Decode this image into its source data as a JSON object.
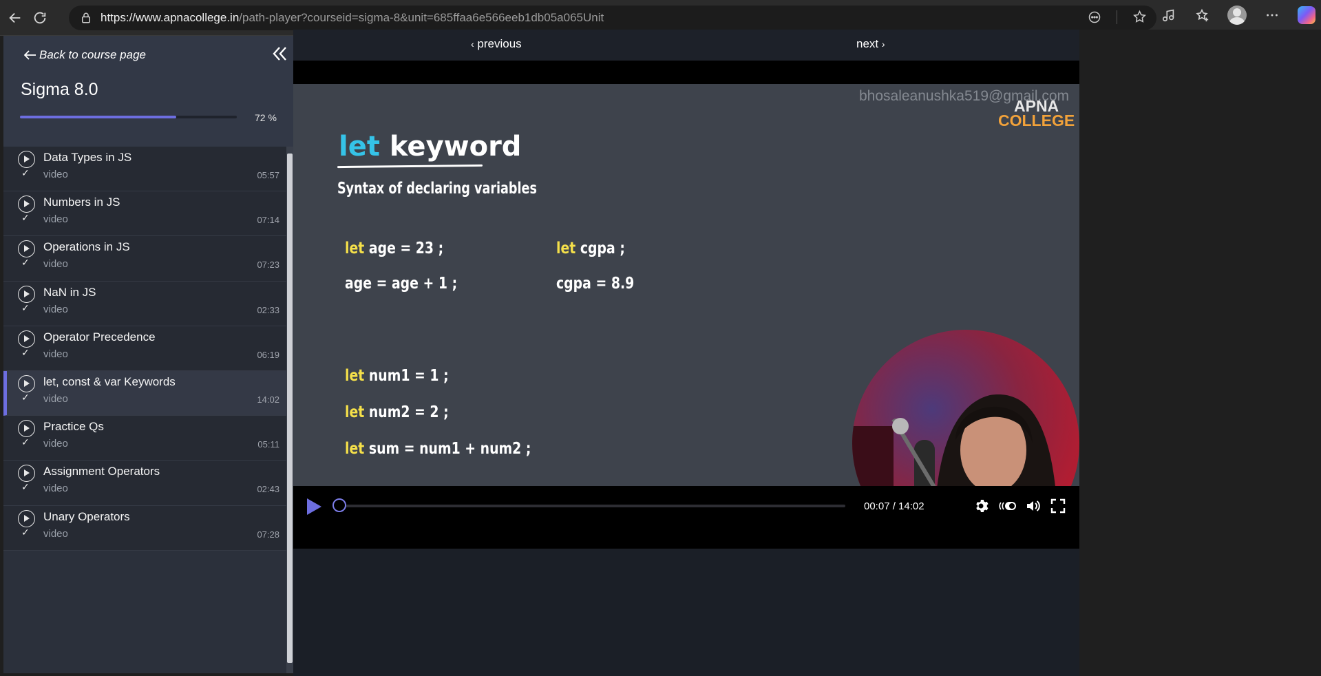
{
  "browser": {
    "url_host": "https://www.apnacollege.in",
    "url_path": "/path-player?courseid=sigma-8&unit=685ffaa6e566eeb1db05a065Unit"
  },
  "sidebar": {
    "back_label": "Back to course page",
    "course_title": "Sigma 8.0",
    "progress_label": "72 %",
    "progress_fraction": 0.72,
    "lessons": [
      {
        "title": "Data Types in JS",
        "type": "video",
        "duration": "05:57"
      },
      {
        "title": "Numbers in JS",
        "type": "video",
        "duration": "07:14"
      },
      {
        "title": "Operations in JS",
        "type": "video",
        "duration": "07:23"
      },
      {
        "title": "NaN in JS",
        "type": "video",
        "duration": "02:33"
      },
      {
        "title": " Operator Precedence",
        "type": "video",
        "duration": "06:19"
      },
      {
        "title": "let, const & var Keywords",
        "type": "video",
        "duration": "14:02"
      },
      {
        "title": "Practice Qs",
        "type": "video",
        "duration": "05:11"
      },
      {
        "title": "Assignment Operators",
        "type": "video",
        "duration": "02:43"
      },
      {
        "title": "Unary Operators",
        "type": "video",
        "duration": "07:28"
      }
    ],
    "active_index": 5
  },
  "player": {
    "previous_label": "previous",
    "next_label": "next",
    "watermark": "bhosaleanushka519@gmail.com",
    "logo_line1": "APNA",
    "logo_line2": "COLLEGE",
    "time": "00:07 / 14:02",
    "played_fraction": 0.008
  },
  "slide": {
    "title_kw": "let",
    "title_rest": "keyword",
    "subtitle": "Syntax of declaring variables",
    "code_left": [
      {
        "k": "let",
        "rest": "age = 23 ;"
      },
      {
        "k": "",
        "rest": "age = age + 1 ;"
      }
    ],
    "code_right": [
      {
        "k": "let",
        "rest": "cgpa ;"
      },
      {
        "k": "",
        "rest": "cgpa = 8.9"
      }
    ],
    "code_bottom": [
      {
        "k": "let",
        "rest": "num1 = 1 ;"
      },
      {
        "k": "let",
        "rest": "num2 = 2 ;"
      },
      {
        "k": "let",
        "rest": "sum = num1 + num2 ;"
      }
    ]
  },
  "colors": {
    "accent": "#6d6ee0",
    "keyword_blue": "#35c3e8",
    "keyword_yellow": "#f5e04a",
    "logo_orange": "#f2a23a"
  }
}
